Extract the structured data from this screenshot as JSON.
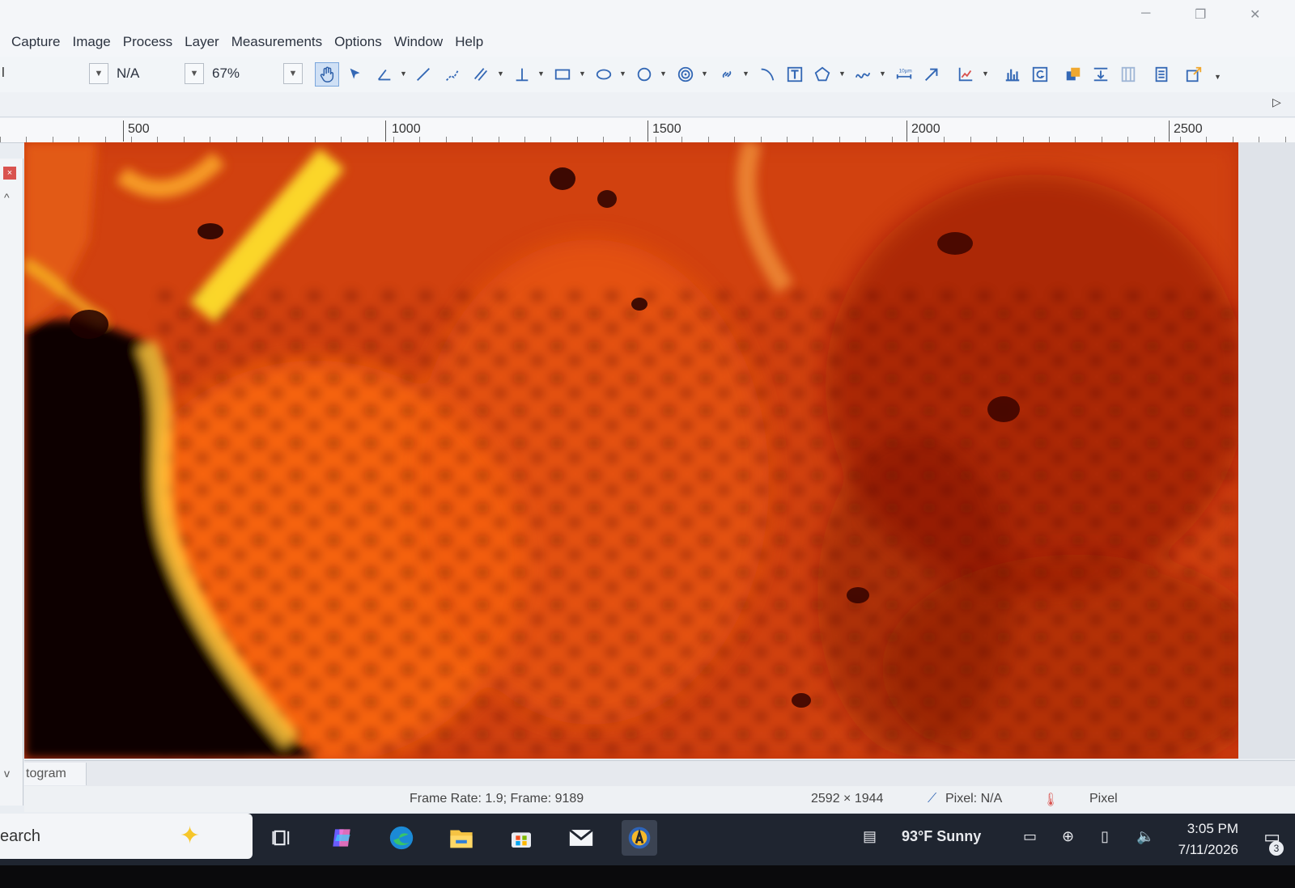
{
  "window": {
    "minimize_glyph": "─",
    "restore_glyph": "❐",
    "close_glyph": "✕"
  },
  "menu": [
    "Capture",
    "Image",
    "Process",
    "Layer",
    "Measurements",
    "Options",
    "Window",
    "Help"
  ],
  "toolbar": {
    "left_edge_label": "l",
    "combo1_value": "N/A",
    "zoom_value": "67%",
    "tools": [
      "hand-pan",
      "select-arrow",
      "angle",
      "line",
      "polyline",
      "parallel-lines",
      "perpendicular",
      "rectangle",
      "ellipse",
      "circle",
      "concentric-circles",
      "link",
      "arc",
      "text",
      "polygon",
      "curve",
      "scale-bar",
      "arrow",
      "measure-chart",
      "histogram",
      "g-tool",
      "overlay",
      "align",
      "columns",
      "report",
      "export"
    ]
  },
  "ruler": {
    "labels": [
      "500",
      "1000",
      "1500",
      "2000",
      "2500"
    ]
  },
  "panel": {
    "close_glyph": "×",
    "up_glyph": "^",
    "down_glyph": "v"
  },
  "tabs": {
    "histogram_tab": "togram"
  },
  "status": {
    "frame_info": "Frame Rate: 1.9; Frame: 9189",
    "image_size": "2592 × 1944",
    "pixel_info": "Pixel: N/A",
    "unit": "Pixel"
  },
  "taskbar": {
    "search_text": "earch",
    "weather": "93°F  Sunny",
    "time": "3:05 PM",
    "date": "7/11/2026",
    "notification_count": "3"
  },
  "colors": {
    "image_base": "#c2330a",
    "image_bright": "#ffcf2a",
    "image_dark": "#230000",
    "accent": "#3468b5"
  }
}
